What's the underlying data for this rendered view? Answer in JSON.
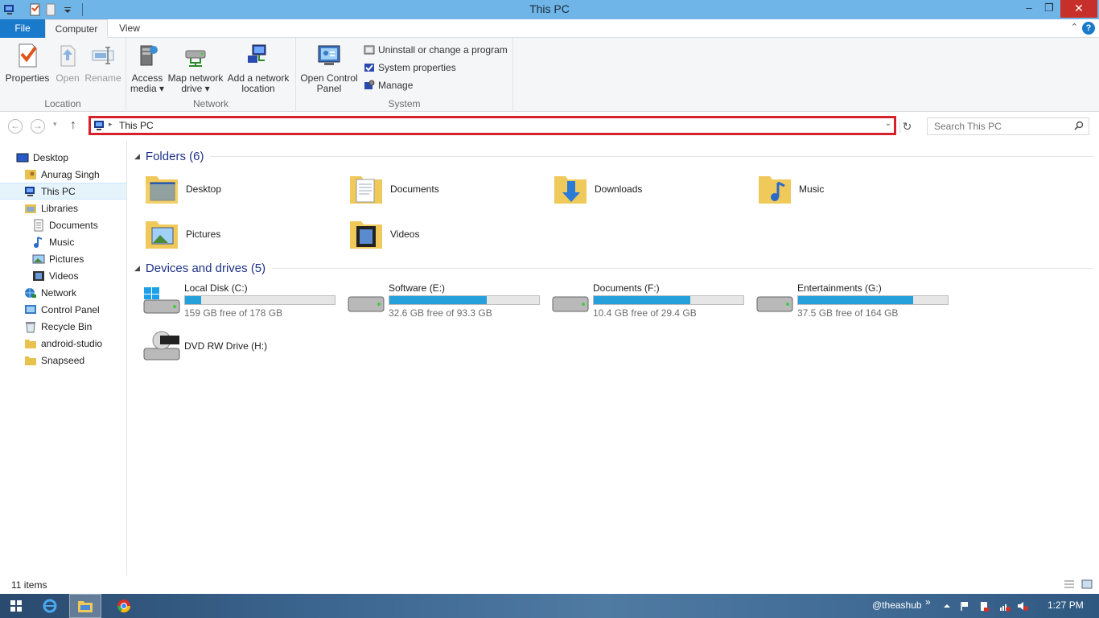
{
  "window": {
    "title": "This PC",
    "minimize": "–",
    "maximize": "❐",
    "close": "✕"
  },
  "ribbon": {
    "tabs": [
      "File",
      "Computer",
      "View"
    ],
    "groups": {
      "location": {
        "label": "Location",
        "buttons": [
          "Properties",
          "Open",
          "Rename"
        ]
      },
      "network": {
        "label": "Network",
        "access_media": [
          "Access",
          "media ▾"
        ],
        "map_network_drive": [
          "Map network",
          "drive ▾"
        ],
        "add_network_location": [
          "Add a network",
          "location"
        ]
      },
      "system": {
        "label": "System",
        "open_control_panel": [
          "Open Control",
          "Panel"
        ],
        "small_buttons": [
          "Uninstall or change a program",
          "System properties",
          "Manage"
        ]
      }
    },
    "help": "?"
  },
  "navigation": {
    "back": "←",
    "forward": "→",
    "recent": "▾",
    "up": "↑",
    "address_path": "This PC",
    "search_placeholder": "Search This PC"
  },
  "sidebar": {
    "items": [
      {
        "label": "Desktop",
        "icon": "desktop-icon"
      },
      {
        "label": "Anurag Singh",
        "icon": "user-folder-icon"
      },
      {
        "label": "This PC",
        "icon": "computer-icon",
        "selected": true
      },
      {
        "label": "Libraries",
        "icon": "libraries-icon"
      },
      {
        "label": "Documents",
        "icon": "documents-icon"
      },
      {
        "label": "Music",
        "icon": "music-icon"
      },
      {
        "label": "Pictures",
        "icon": "pictures-icon"
      },
      {
        "label": "Videos",
        "icon": "videos-icon"
      },
      {
        "label": "Network",
        "icon": "network-icon"
      },
      {
        "label": "Control Panel",
        "icon": "control-panel-icon"
      },
      {
        "label": "Recycle Bin",
        "icon": "recycle-bin-icon"
      },
      {
        "label": "android-studio",
        "icon": "folder-icon"
      },
      {
        "label": "Snapseed",
        "icon": "folder-icon"
      }
    ]
  },
  "content": {
    "folders_header": "Folders (6)",
    "folders": [
      {
        "name": "Desktop",
        "icon": "desktop-folder-icon"
      },
      {
        "name": "Documents",
        "icon": "documents-folder-icon"
      },
      {
        "name": "Downloads",
        "icon": "downloads-folder-icon"
      },
      {
        "name": "Music",
        "icon": "music-folder-icon"
      },
      {
        "name": "Pictures",
        "icon": "pictures-folder-icon"
      },
      {
        "name": "Videos",
        "icon": "videos-folder-icon"
      }
    ],
    "drives_header": "Devices and drives (5)",
    "drives": [
      {
        "name": "Local Disk (C:)",
        "free": "159 GB free of 178 GB",
        "used_fraction": 0.107,
        "icon": "windows-drive-icon"
      },
      {
        "name": "Software (E:)",
        "free": "32.6 GB free of 93.3 GB",
        "used_fraction": 0.65,
        "icon": "hard-drive-icon"
      },
      {
        "name": "Documents (F:)",
        "free": "10.4 GB free of 29.4 GB",
        "used_fraction": 0.646,
        "icon": "hard-drive-icon"
      },
      {
        "name": "Entertainments (G:)",
        "free": "37.5 GB free of 164 GB",
        "used_fraction": 0.771,
        "icon": "hard-drive-icon"
      },
      {
        "name": "DVD RW Drive (H:)",
        "icon": "dvd-drive-icon"
      }
    ]
  },
  "status": {
    "item_count": "11 items"
  },
  "taskbar": {
    "apps": [
      "start-icon",
      "internet-explorer-icon",
      "file-explorer-icon",
      "chrome-icon"
    ],
    "tray_label": "@theashub",
    "tray_more": "»",
    "clock": "1:27 PM"
  },
  "colors": {
    "titlebar": "#6fb5e8",
    "file_tab": "#1979ca",
    "drive_fill": "#26a0da",
    "highlight_border": "#d6202a",
    "section_header": "#1e3287"
  }
}
